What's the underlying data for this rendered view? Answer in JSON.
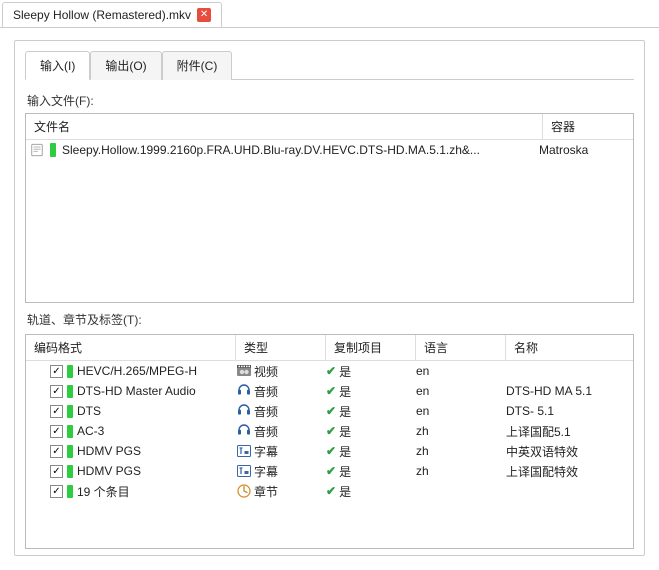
{
  "outer_tab": {
    "title": "Sleepy Hollow (Remastered).mkv"
  },
  "tabs": {
    "input": "输入(I)",
    "output": "输出(O)",
    "attachments": "附件(C)"
  },
  "labels": {
    "input_files": "输入文件(F):",
    "tracks": "轨道、章节及标签(T):",
    "col_filename": "文件名",
    "col_container": "容器",
    "col_codec": "编码格式",
    "col_type": "类型",
    "col_copy": "复制项目",
    "col_lang": "语言",
    "col_name": "名称",
    "copy_yes": "是"
  },
  "file": {
    "name": "Sleepy.Hollow.1999.2160p.FRA.UHD.Blu-ray.DV.HEVC.DTS-HD.MA.5.1.zh&...",
    "container": "Matroska"
  },
  "tracks_rows": [
    {
      "codec": "HEVC/H.265/MPEG-H",
      "type": "视频",
      "type_icon": "video",
      "lang": "en",
      "name": ""
    },
    {
      "codec": "DTS-HD Master Audio",
      "type": "音频",
      "type_icon": "audio",
      "lang": "en",
      "name": "DTS-HD MA 5.1"
    },
    {
      "codec": "DTS",
      "type": "音频",
      "type_icon": "audio",
      "lang": "en",
      "name": "DTS- 5.1"
    },
    {
      "codec": "AC-3",
      "type": "音频",
      "type_icon": "audio",
      "lang": "zh",
      "name": "上译国配5.1"
    },
    {
      "codec": "HDMV PGS",
      "type": "字幕",
      "type_icon": "subtitle",
      "lang": "zh",
      "name": "中英双语特效"
    },
    {
      "codec": "HDMV PGS",
      "type": "字幕",
      "type_icon": "subtitle",
      "lang": "zh",
      "name": "上译国配特效"
    },
    {
      "codec": "19 个条目",
      "type": "章节",
      "type_icon": "chapter",
      "lang": "",
      "name": ""
    }
  ]
}
